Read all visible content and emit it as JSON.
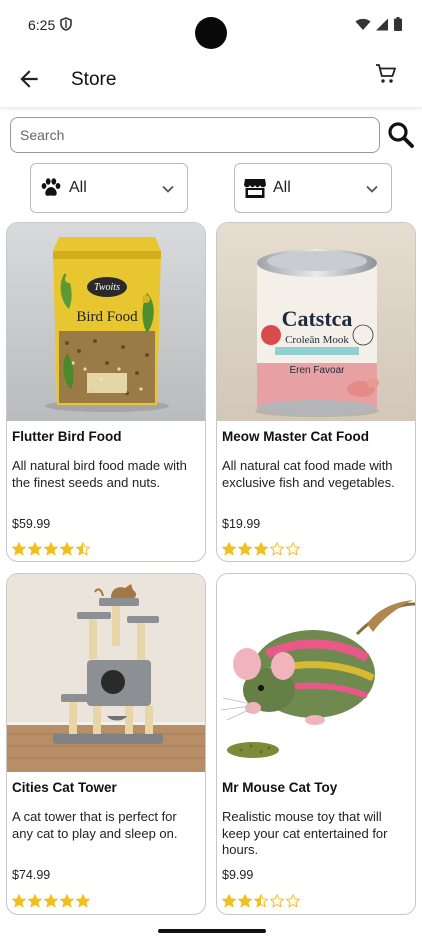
{
  "status_bar": {
    "time": "6:25"
  },
  "app_bar": {
    "title": "Store"
  },
  "search": {
    "placeholder": "Search",
    "value": ""
  },
  "filters": {
    "pet": {
      "label": "All",
      "icon": "paw-icon"
    },
    "store": {
      "label": "All",
      "icon": "storefront-icon"
    }
  },
  "colors": {
    "star": "#f2c01e",
    "border": "#c8c8c8"
  },
  "products": [
    {
      "name": "Flutter Bird Food",
      "description": "All natural bird food made with the finest seeds and nuts.",
      "price": "$59.99",
      "rating": 4.5
    },
    {
      "name": "Meow Master Cat Food",
      "description": "All natural cat food made with exclusive fish and vegetables.",
      "price": "$19.99",
      "rating": 3
    },
    {
      "name": "Cities Cat Tower",
      "description": "A cat tower that is perfect for any cat to play and sleep on.",
      "price": "$74.99",
      "rating": 5
    },
    {
      "name": "Mr Mouse Cat Toy",
      "description": "Realistic mouse toy that will keep your cat entertained for hours.",
      "price": "$9.99",
      "rating": 2.5
    }
  ]
}
